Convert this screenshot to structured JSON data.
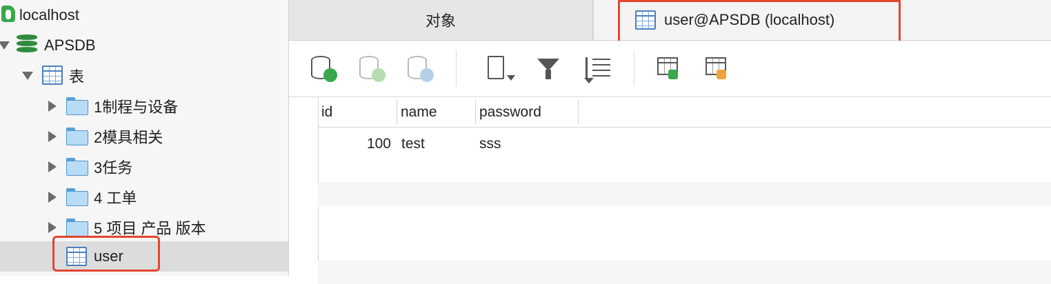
{
  "sidebar": {
    "server_label": "localhost",
    "database_label": "APSDB",
    "tables_group_label": "表",
    "folders": [
      {
        "label": "1制程与设备"
      },
      {
        "label": "2模具相关"
      },
      {
        "label": "3任务"
      },
      {
        "label": "4 工单"
      },
      {
        "label": "5 项目 产品 版本"
      }
    ],
    "selected_table_label": "user"
  },
  "tabs": {
    "objects_label": "对象",
    "active_label": "user@APSDB (localhost)"
  },
  "toolbar": {
    "icons": [
      "new-record-icon",
      "apply-changes-icon",
      "discard-changes-icon",
      "text-view-icon",
      "filter-icon",
      "sort-icon",
      "import-icon",
      "export-icon"
    ]
  },
  "grid": {
    "columns": [
      "id",
      "name",
      "password"
    ],
    "rows": [
      {
        "id": "100",
        "name": "test",
        "password": "sss"
      }
    ]
  },
  "colors": {
    "highlight": "#e2462f",
    "table_icon": "#4a7fbe",
    "database_icon": "#2e8c3c",
    "folder_fill": "#b8dcf6"
  }
}
